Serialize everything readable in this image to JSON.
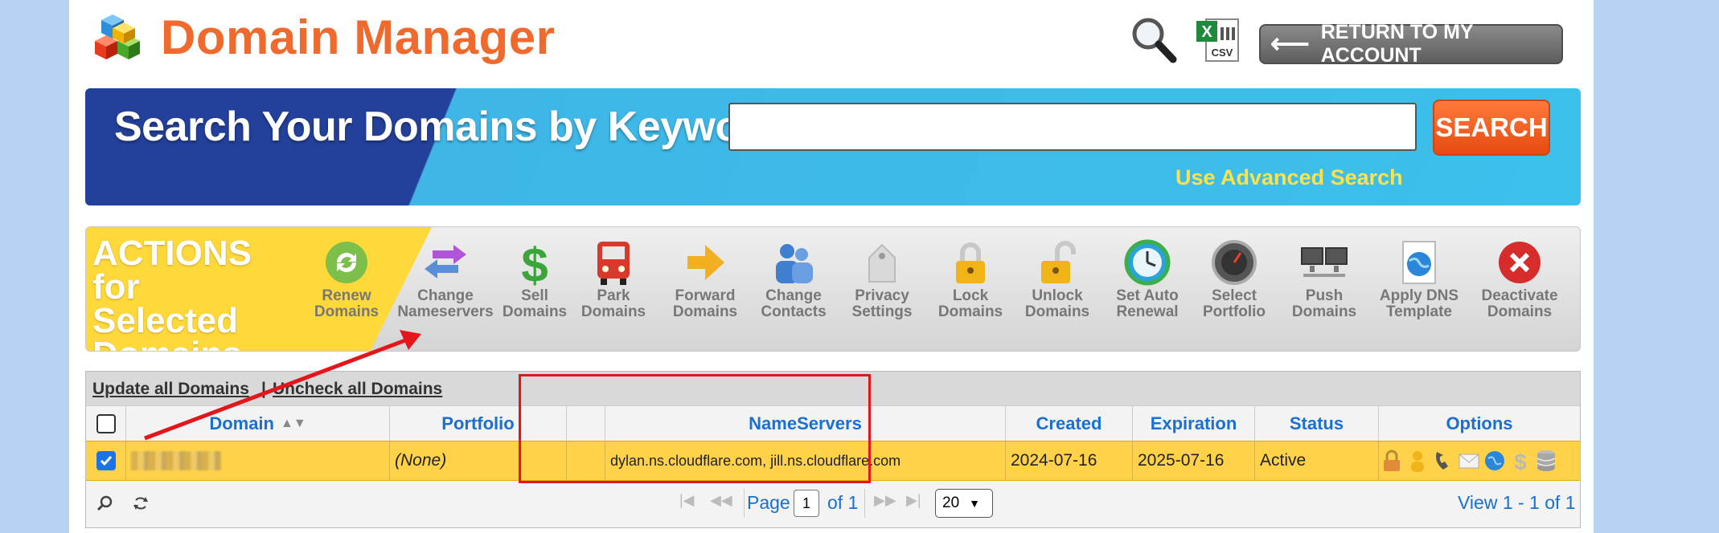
{
  "header": {
    "title": "Domain Manager",
    "search_icon": "magnifier-icon",
    "csv_icon": "csv-export-icon",
    "csv_label": "CSV",
    "return_button": "RETURN TO MY ACCOUNT"
  },
  "search": {
    "heading": "Search Your Domains by Keyword",
    "placeholder": "",
    "button": "SEARCH",
    "advanced_link": "Use Advanced Search"
  },
  "actions": {
    "heading": "ACTIONS for Selected Domains",
    "items": [
      {
        "label": "Renew Domains",
        "icon": "renew-icon"
      },
      {
        "label": "Change Nameservers",
        "icon": "nameservers-icon"
      },
      {
        "label": "Sell Domains",
        "icon": "dollar-icon"
      },
      {
        "label": "Park Domains",
        "icon": "bus-icon"
      },
      {
        "label": "Forward Domains",
        "icon": "forward-arrow-icon"
      },
      {
        "label": "Change Contacts",
        "icon": "contacts-icon"
      },
      {
        "label": "Privacy Settings",
        "icon": "privacy-tag-icon"
      },
      {
        "label": "Lock Domains",
        "icon": "lock-icon"
      },
      {
        "label": "Unlock Domains",
        "icon": "unlock-icon"
      },
      {
        "label": "Set Auto Renewal",
        "icon": "clock-icon"
      },
      {
        "label": "Select Portfolio",
        "icon": "gauge-icon"
      },
      {
        "label": "Push Domains",
        "icon": "monitors-icon"
      },
      {
        "label": "Apply DNS Template",
        "icon": "globe-document-icon"
      },
      {
        "label": "Deactivate Domains",
        "icon": "close-circle-icon"
      }
    ]
  },
  "table": {
    "links": {
      "update_all": "Update all Domains",
      "separator": "|",
      "uncheck_all": "Uncheck all Domains"
    },
    "columns": [
      "Domain",
      "Portfolio",
      "NameServers",
      "Created",
      "Expiration",
      "Status",
      "Options"
    ],
    "sort_icon": "sort-icon",
    "rows": [
      {
        "checked": true,
        "domain": "",
        "portfolio": "(None)",
        "nameservers": "dylan.ns.cloudflare.com, jill.ns.cloudflare.com",
        "created": "2024-07-16",
        "expiration": "2025-07-16",
        "status": "Active",
        "options": [
          "lock-icon",
          "contact-icon",
          "phone-icon",
          "mail-icon",
          "globe-icon",
          "dollar-icon",
          "database-icon"
        ]
      }
    ],
    "footer": {
      "page_label": "Page",
      "page_value": "1",
      "of_label": "of 1",
      "per_page": "20",
      "view_text": "View 1 - 1 of 1"
    }
  },
  "colors": {
    "brand_orange": "#ef6a2c",
    "banner_blue": "#23409a",
    "highlight_row": "#ffd24a",
    "annotation_red": "#e5161b"
  }
}
